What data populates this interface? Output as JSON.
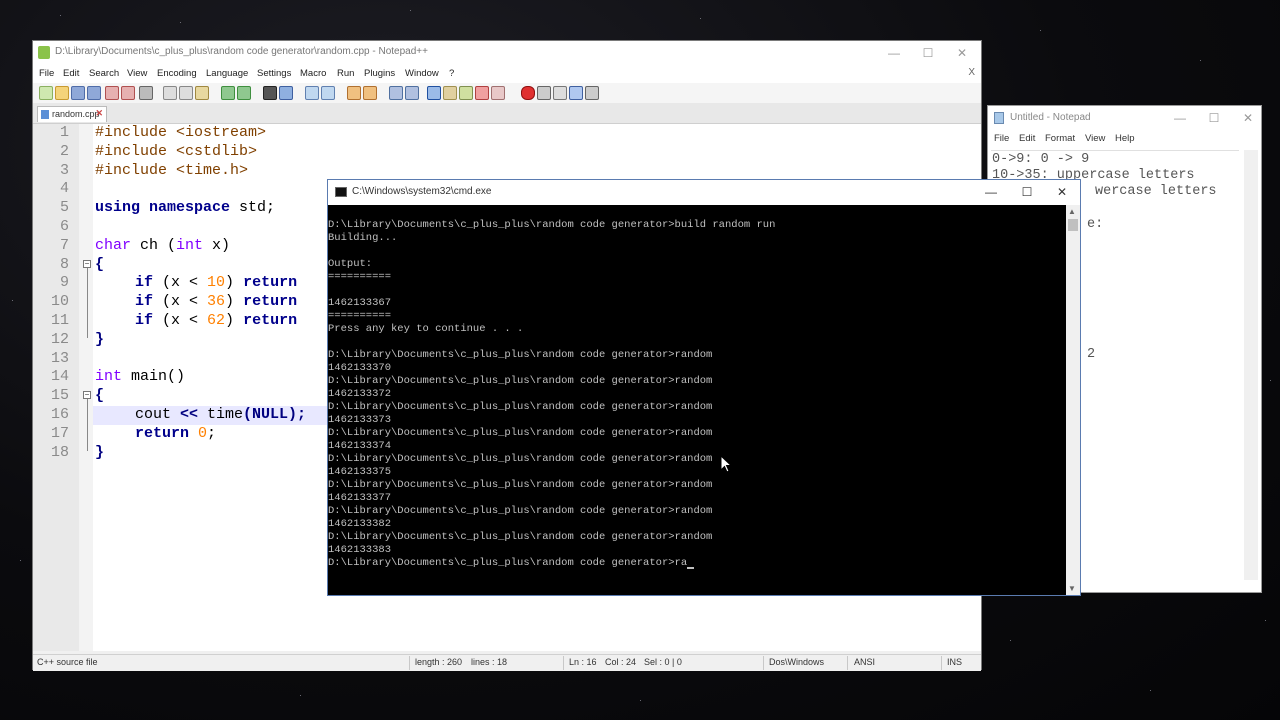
{
  "npp": {
    "title": "D:\\Library\\Documents\\c_plus_plus\\random code generator\\random.cpp - Notepad++",
    "menu": [
      "File",
      "Edit",
      "Search",
      "View",
      "Encoding",
      "Language",
      "Settings",
      "Macro",
      "Run",
      "Plugins",
      "Window",
      "?"
    ],
    "close_x": "X",
    "tab_label": "random.cpp",
    "line_numbers": [
      "1",
      "2",
      "3",
      "4",
      "5",
      "6",
      "7",
      "8",
      "9",
      "10",
      "11",
      "12",
      "13",
      "14",
      "15",
      "16",
      "17",
      "18"
    ],
    "code": {
      "l1": "#include <iostream>",
      "l2": "#include <cstdlib>",
      "l3": "#include <time.h>",
      "l5a": "using namespace",
      "l5b": " std;",
      "l7a": "char",
      "l7b": " ch (",
      "l7c": "int",
      "l7d": " x)",
      "brace_open": "{",
      "brace_close": "}",
      "if": "if",
      "cond_a": " (x < ",
      "ten": "10",
      "thirtysix": "36",
      "sixtytwo": "62",
      "cond_b": ") ",
      "return": "return",
      "l14a": "int",
      "l14b": " main()",
      "l16a": "cout",
      "l16b": " << ",
      "l16c": "time",
      "l16d": "(NULL);",
      "l17b": " ",
      "zero": "0",
      "semi": ";"
    },
    "status": {
      "file_type": "C++ source file",
      "length": "length : 260",
      "lines": "lines : 18",
      "ln": "Ln : 16",
      "col": "Col : 24",
      "sel": "Sel : 0 | 0",
      "eol": "Dos\\Windows",
      "encoding": "ANSI",
      "mode": "INS"
    }
  },
  "notepad": {
    "title": "Untitled - Notepad",
    "menu": [
      "File",
      "Edit",
      "Format",
      "View",
      "Help"
    ],
    "lines": [
      "0->9: 0 -> 9",
      "10->35: uppercase letters",
      "wercase letters",
      "e:",
      "2"
    ]
  },
  "cmd": {
    "title": "C:\\Windows\\system32\\cmd.exe",
    "lines": [
      "D:\\Library\\Documents\\c_plus_plus\\random code generator>build random run",
      "Building...",
      "",
      "Output:",
      "==========",
      "",
      "1462133367",
      "==========",
      "Press any key to continue . . .",
      "",
      "D:\\Library\\Documents\\c_plus_plus\\random code generator>random",
      "1462133370",
      "D:\\Library\\Documents\\c_plus_plus\\random code generator>random",
      "1462133372",
      "D:\\Library\\Documents\\c_plus_plus\\random code generator>random",
      "1462133373",
      "D:\\Library\\Documents\\c_plus_plus\\random code generator>random",
      "1462133374",
      "D:\\Library\\Documents\\c_plus_plus\\random code generator>random",
      "1462133375",
      "D:\\Library\\Documents\\c_plus_plus\\random code generator>random",
      "1462133377",
      "D:\\Library\\Documents\\c_plus_plus\\random code generator>random",
      "1462133382",
      "D:\\Library\\Documents\\c_plus_plus\\random code generator>random",
      "1462133383",
      "D:\\Library\\Documents\\c_plus_plus\\random code generator>ra"
    ]
  },
  "window_controls": {
    "minimize": "—",
    "maximize": "☐",
    "close": "✕"
  },
  "colors": {
    "npp_keyword": "#00008b",
    "npp_type": "#8000ff",
    "npp_number": "#ff8000",
    "cmd_text": "#c0c0c0"
  }
}
